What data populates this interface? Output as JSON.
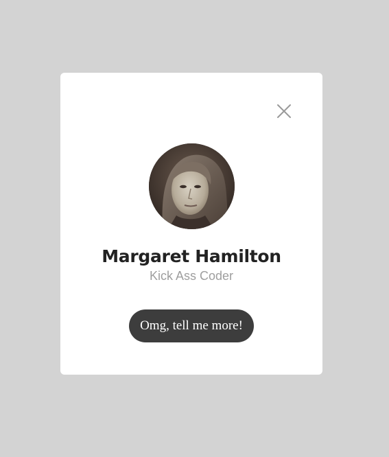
{
  "profile_card": {
    "name": "Margaret Hamilton",
    "subtitle": "Kick Ass Coder",
    "cta_label": "Omg, tell me more!",
    "close_icon": "close-icon",
    "avatar_icon": "portrait-photo"
  },
  "colors": {
    "backdrop": "#d3d3d3",
    "card": "#ffffff",
    "name_text": "#222222",
    "subtitle_text": "#9e9e9e",
    "button_bg": "#3d3d3d",
    "button_text": "#ffffff",
    "close_icon": "#9a9a9a"
  }
}
